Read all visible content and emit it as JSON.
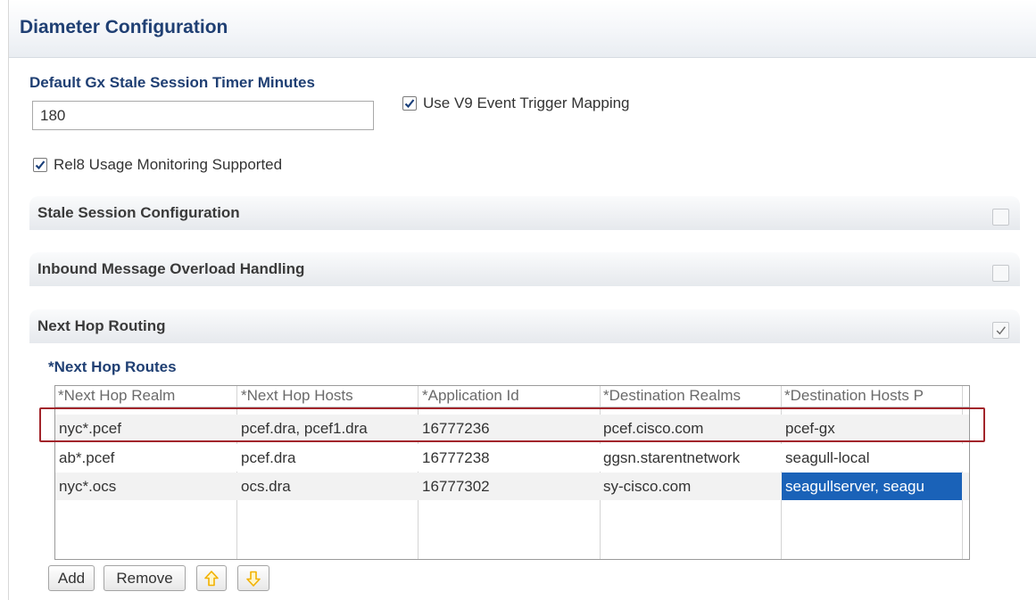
{
  "header": {
    "title": "Diameter Configuration"
  },
  "form": {
    "stale_timer_label": "Default Gx Stale Session Timer Minutes",
    "stale_timer_value": "180",
    "use_v9_label": "Use V9 Event Trigger Mapping",
    "use_v9_checked": true,
    "rel8_label": "Rel8 Usage Monitoring Supported",
    "rel8_checked": true
  },
  "sections": [
    {
      "title": "Stale Session Configuration",
      "checked": false
    },
    {
      "title": "Inbound Message Overload Handling",
      "checked": false
    },
    {
      "title": "Next Hop Routing",
      "checked": true
    }
  ],
  "routes": {
    "label": "*Next Hop Routes",
    "columns": [
      "*Next Hop Realm",
      "*Next Hop Hosts",
      "*Application Id",
      "*Destination Realms",
      "*Destination Hosts P"
    ],
    "rows": [
      [
        "nyc*.pcef",
        "pcef.dra, pcef1.dra",
        "16777236",
        "pcef.cisco.com",
        "pcef-gx"
      ],
      [
        "ab*.pcef",
        "pcef.dra",
        "16777238",
        "ggsn.starentnetwork",
        "seagull-local"
      ],
      [
        "nyc*.ocs",
        "ocs.dra",
        "16777302",
        "sy-cisco.com",
        "seagullserver, seagu"
      ]
    ]
  },
  "buttons": {
    "add": "Add",
    "remove": "Remove"
  },
  "icons": {
    "move_up": "arrow-up-icon",
    "move_down": "arrow-down-icon",
    "check": "checkmark-icon"
  },
  "colors": {
    "heading": "#1f3f73",
    "selection": "#1a62b8",
    "highlight_border": "#a2252b",
    "arrow": "#f2b100"
  }
}
